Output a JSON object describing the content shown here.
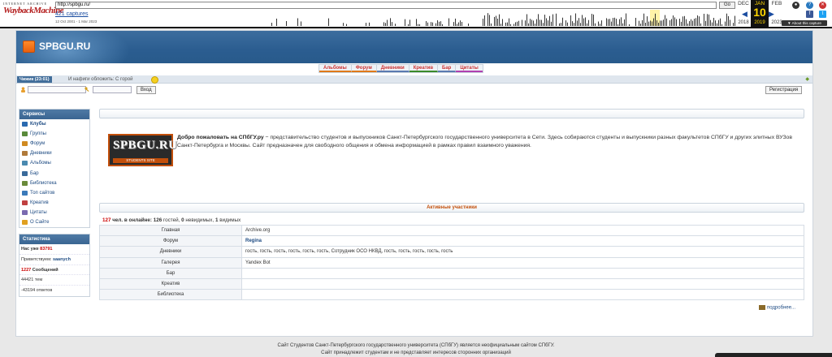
{
  "wayback": {
    "logo_top": "INTERNET ARCHIVE",
    "logo_main": "WaybackMachine",
    "url": "http://spbgu.ru/",
    "go_label": "Go",
    "captures": "421 captures",
    "date_range": "12 Oct 2001 - 1 Mar 2023",
    "months": [
      {
        "month": "DEC",
        "year": "2018"
      },
      {
        "month": "JAN",
        "day": "10",
        "year": "2019"
      },
      {
        "month": "FEB",
        "year": "2023"
      }
    ],
    "about": "▼ About this capture"
  },
  "site": {
    "logo_text": "SPBGU.RU",
    "nav": [
      "Альбомы",
      "Форум",
      "Дневники",
      "Креатив",
      "Бар",
      "Цитаты"
    ],
    "chat_tab": "Чижик (23:01)",
    "chat_msg": "И нафиги обложить: С горой",
    "login_button": "Вход",
    "register_button": "Регистрация"
  },
  "sidebar": {
    "services_title": "Сервисы",
    "services": [
      {
        "label": "Клубы",
        "icon": "clubs-icon",
        "color": "#2a6ab0",
        "bold": true
      },
      {
        "label": "Группы",
        "icon": "groups-icon",
        "color": "#5a8a3a"
      },
      {
        "label": "Форум",
        "icon": "forum-icon",
        "color": "#d08a20"
      },
      {
        "label": "Дневники",
        "icon": "diary-icon",
        "color": "#b07a3a"
      },
      {
        "label": "Альбомы",
        "icon": "albums-icon",
        "color": "#4a8ab0"
      },
      {
        "label": "Бар",
        "icon": "bar-icon",
        "color": "#3a6a9a"
      },
      {
        "label": "Библиотека",
        "icon": "library-icon",
        "color": "#6a8a3a"
      },
      {
        "label": "Топ сайтов",
        "icon": "top-sites-icon",
        "color": "#3a7aba"
      },
      {
        "label": "Креатив",
        "icon": "creative-icon",
        "color": "#c04040"
      },
      {
        "label": "Цитаты",
        "icon": "quotes-icon",
        "color": "#7a6ab0"
      },
      {
        "label": "О Сайте",
        "icon": "about-icon",
        "color": "#e0a020"
      }
    ],
    "stats_title": "Статистика",
    "stats": {
      "members_prefix": "Нас уже",
      "members_count": "83791",
      "greet_prefix": "Приветствуем:",
      "greet_name": "saanych",
      "messages_count": "1227",
      "messages_label": "Сообщений",
      "topics": "44421 тем",
      "replies": "-43194 ответов"
    }
  },
  "welcome": {
    "logo_main": "SPBGU.RU",
    "logo_sub": "STUDENTS SITE",
    "title": "Добро пожаловать на СПбГУ.ру",
    "text": " − представительство студентов и выпускников Санкт-Петербургского государственного университета в Сети. Здесь собираются студенты и выпускники разных факультетов СПбГУ и других элитных ВУЗов Санкт-Петербурга и Москвы. Сайт предназначен для свободного общения и обмена информацией в рамках правил взаимного уважения."
  },
  "active": {
    "title": "Активные участники",
    "online_count": "127",
    "online_label": "чел. в онлайне:",
    "guests_count": "126",
    "guests_label": "гостей,",
    "invisible_count": "0",
    "invisible_label": "невидимых,",
    "visible_count": "1",
    "visible_label": "видимых",
    "rows": [
      {
        "section": "Главная",
        "users": "Archive.org"
      },
      {
        "section": "Форум",
        "users": "Regina",
        "link": true
      },
      {
        "section": "Дневники",
        "users": "гость, гость, гость, гость, гость, гость, Сотрудник ОСО НКВД, гость, гость, гость, гость, гость"
      },
      {
        "section": "Галерея",
        "users": "Yandex Bot"
      },
      {
        "section": "Бар",
        "users": ""
      },
      {
        "section": "Креатив",
        "users": ""
      },
      {
        "section": "Библиотека",
        "users": ""
      }
    ],
    "more": "подробнее..."
  },
  "footer": {
    "line1": "Сайт Студентов Санкт-Петербургского государственного университета (СПбГУ) является неофициальным сайтом СПбГУ.",
    "line2": "Сайт принадлежит студентам и не представляет интересов сторонних организаций"
  },
  "colors": {
    "header_blue": "#2b5d90",
    "accent_orange": "#c24f0b",
    "link_blue": "#1c4a82",
    "nav_red": "#cc3333"
  }
}
